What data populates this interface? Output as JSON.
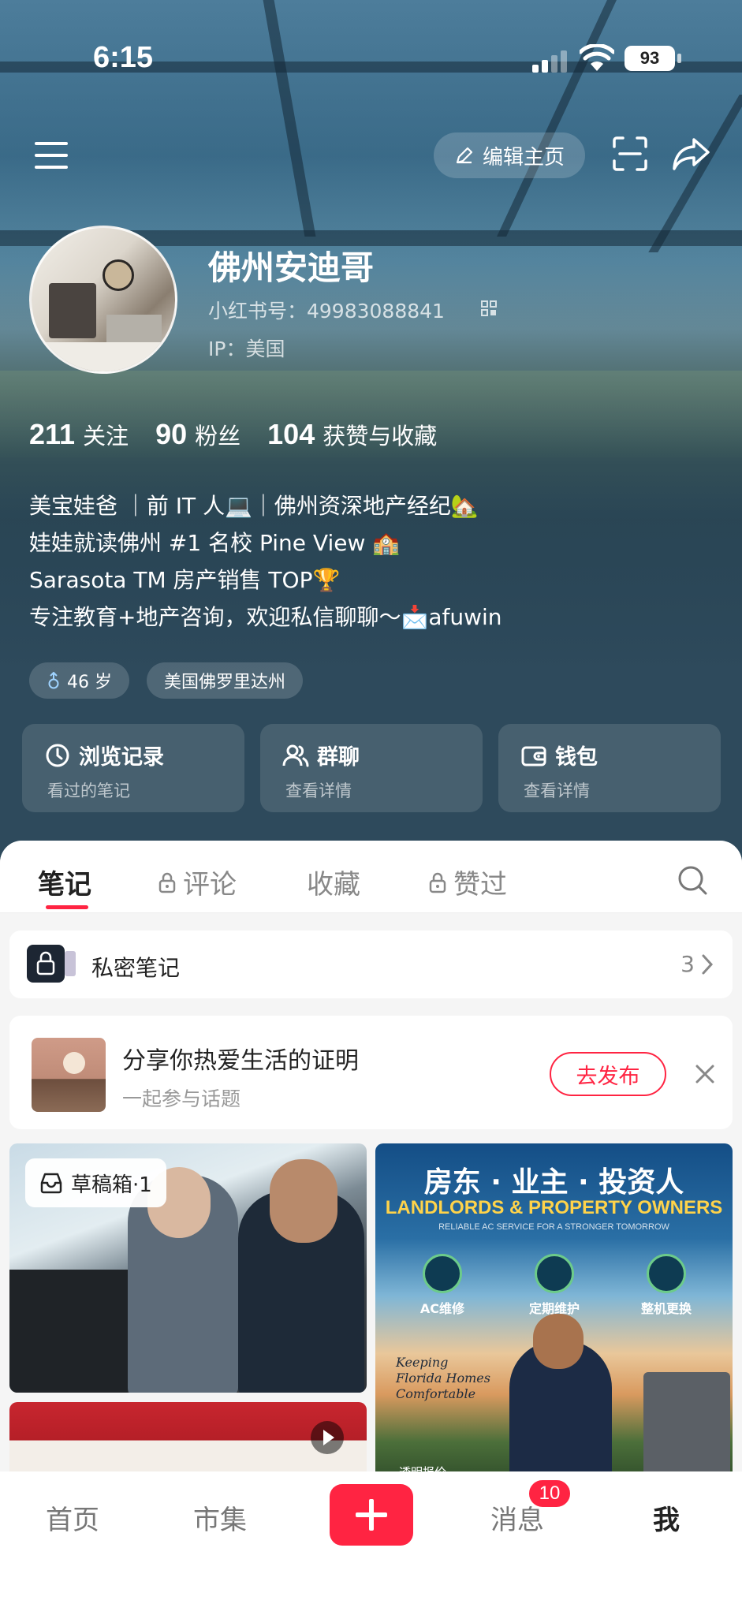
{
  "status_bar": {
    "time": "6:15",
    "battery": "93"
  },
  "top_bar": {
    "edit_label": "编辑主页"
  },
  "profile": {
    "name": "佛州安迪哥",
    "rednote_id": "小红书号：49983088841",
    "ip": "IP：美国"
  },
  "stats": [
    {
      "num": "211",
      "label": "关注"
    },
    {
      "num": "90",
      "label": "粉丝"
    },
    {
      "num": "104",
      "label": "获赞与收藏"
    }
  ],
  "bio": [
    "美宝娃爸 ｜前 IT 人💻｜佛州资深地产经纪🏡",
    "娃娃就读佛州 #1 名校 Pine View 🏫",
    "Sarasota TM 房产销售 TOP🏆",
    "专注教育+地产咨询，欢迎私信聊聊～📩afuwin"
  ],
  "tags": {
    "age": "46 岁",
    "location": "美国佛罗里达州"
  },
  "cards": [
    {
      "title": "浏览记录",
      "sub": "看过的笔记"
    },
    {
      "title": "群聊",
      "sub": "查看详情"
    },
    {
      "title": "钱包",
      "sub": "查看详情"
    }
  ],
  "tabs": [
    {
      "label": "笔记",
      "locked": false
    },
    {
      "label": "评论",
      "locked": true
    },
    {
      "label": "收藏",
      "locked": false
    },
    {
      "label": "赞过",
      "locked": true
    }
  ],
  "private_notes": {
    "label": "私密笔记",
    "count": "3"
  },
  "topic": {
    "title": "分享你热爱生活的证明",
    "sub": "一起参与话题",
    "button": "去发布"
  },
  "drafts": {
    "label": "草稿箱·1"
  },
  "ad_tile": {
    "title": "房东 · 业主 · 投资人",
    "subtitle": "LANDLORDS & PROPERTY OWNERS",
    "tagline": "RELIABLE AC SERVICE FOR A STRONGER TOMORROW",
    "services": [
      "AC维修",
      "定期维护",
      "整机更换"
    ],
    "slogan": "Keeping Florida Homes Comfortable",
    "footer": "透明报价"
  },
  "bottom_nav": {
    "home": "首页",
    "market": "市集",
    "messages": "消息",
    "messages_badge": "10",
    "me": "我"
  }
}
